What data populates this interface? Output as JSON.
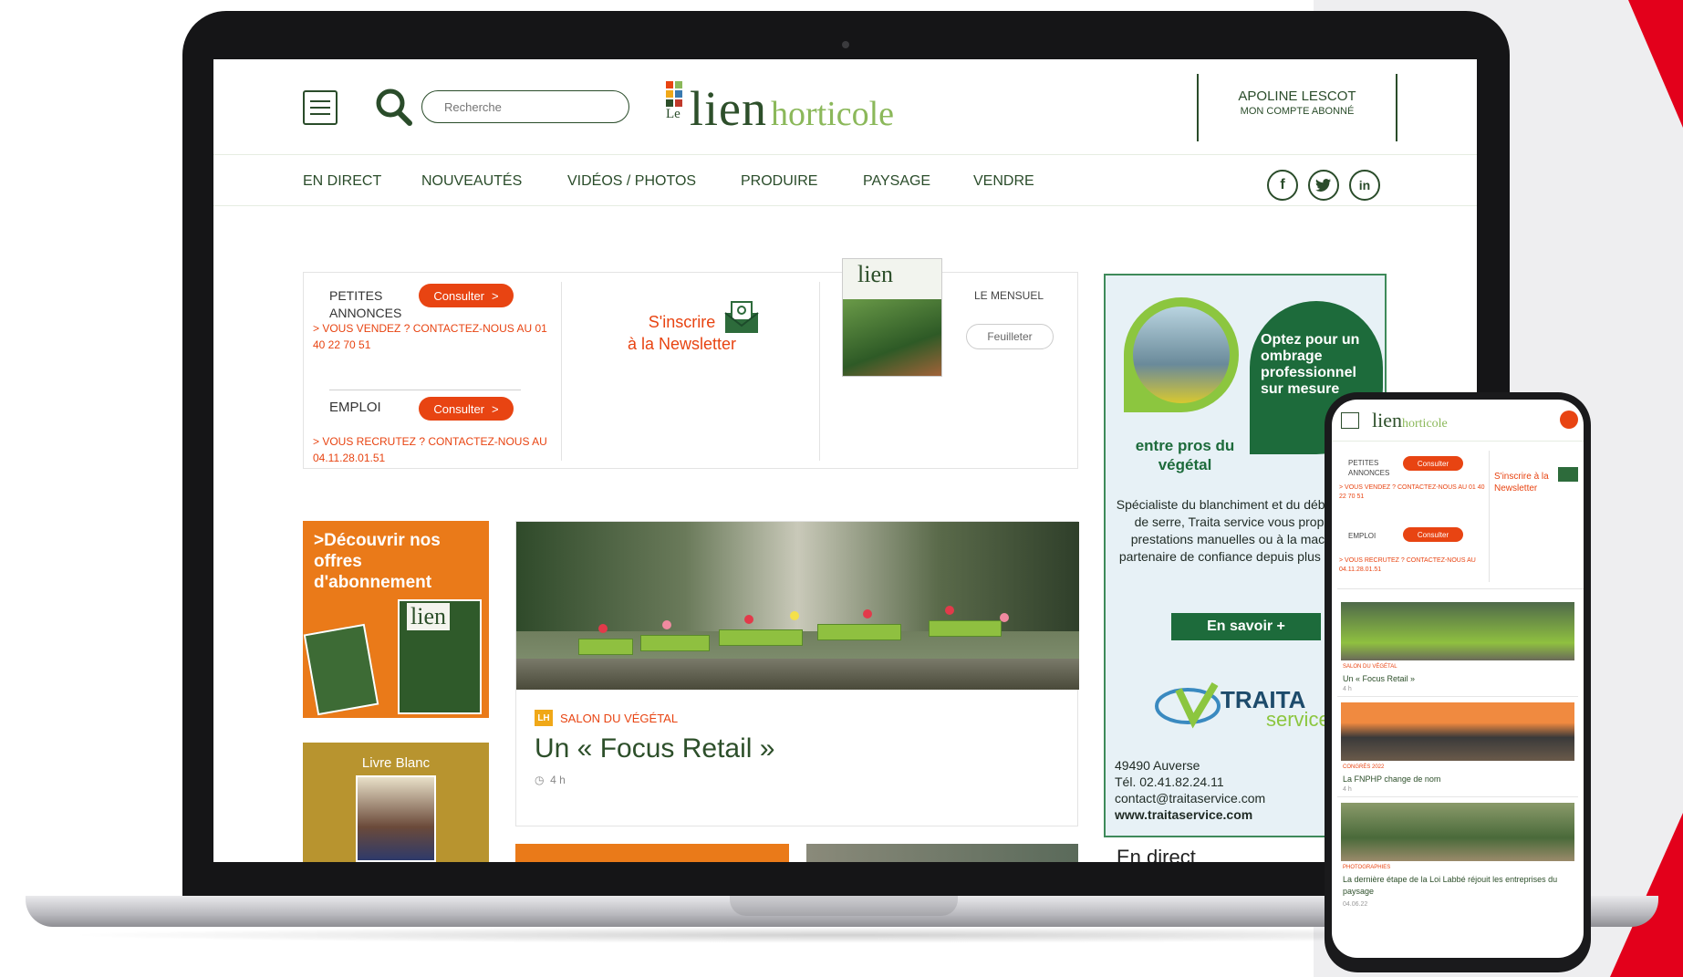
{
  "site": {
    "logo_le": "Le",
    "logo_lien": "lien",
    "logo_horticole": "horticole",
    "search_placeholder": "Recherche"
  },
  "account": {
    "name": "APOLINE LESCOT",
    "sub": "MON COMPTE ABONNÉ"
  },
  "nav": {
    "items": [
      "EN DIRECT",
      "NOUVEAUTÉS",
      "VIDÉOS / PHOTOS",
      "PRODUIRE",
      "PAYSAGE",
      "VENDRE"
    ]
  },
  "social": {
    "facebook": "f",
    "twitter": "t",
    "linkedin": "in"
  },
  "info": {
    "pa_label": "PETITES ANNONCES",
    "pa_button": "Consulter",
    "pa_contact": "> VOUS VENDEZ ? CONTACTEZ-NOUS AU 01 40 22 70 51",
    "emploi_label": "EMPLOI",
    "emploi_button": "Consulter",
    "emploi_contact": "> VOUS RECRUTEZ ? CONTACTEZ-NOUS AU 04.11.28.01.51",
    "newsletter_line1": "S'inscrire",
    "newsletter_line2": "à la Newsletter",
    "mensuel": "LE MENSUEL",
    "feuilleter": "Feuilleter"
  },
  "promos": {
    "abonnement": ">Découvrir nos offres d'abonnement",
    "livre_blanc": "Livre Blanc"
  },
  "article": {
    "category": "SALON DU VÉGÉTAL",
    "badge": "LH",
    "title": "Un « Focus Retail »",
    "time": "4 h"
  },
  "ad": {
    "headline": "Optez pour un ombrage professionnel sur mesure",
    "tagline": "entre pros du végétal",
    "body": "Spécialiste du blanchiment et du déblanchiment de serre, Traita service vous propose des prestations manuelles ou à la machine. Un partenaire de confiance depuis plus de 20 ans.",
    "button": "En savoir +",
    "brand": "TRAITA",
    "brand2": "service",
    "address": "49490 Auverse",
    "phone": "Tél. 02.41.82.24.11",
    "email": "contact@traitaservice.com",
    "web": "www.traitaservice.com"
  },
  "sidebar": {
    "direct_heading": "En direct"
  },
  "colors": {
    "brand_green": "#2d4f2a",
    "accent_orange": "#e84412",
    "ad_green": "#1d6b3b"
  },
  "phone": {
    "newsletter": "S'inscrire à la Newsletter",
    "cards": [
      {
        "category": "SALON DU VÉGÉTAL",
        "title": "Un « Focus Retail »",
        "time": "4 h"
      },
      {
        "category": "CONGRÈS 2022",
        "title": "La FNPHP change de nom",
        "time": "4 h"
      },
      {
        "category": "PHOTOGRAPHIES",
        "title": "La dernière étape de la Loi Labbé réjouit les entreprises du paysage",
        "time": "04.06.22"
      }
    ]
  }
}
